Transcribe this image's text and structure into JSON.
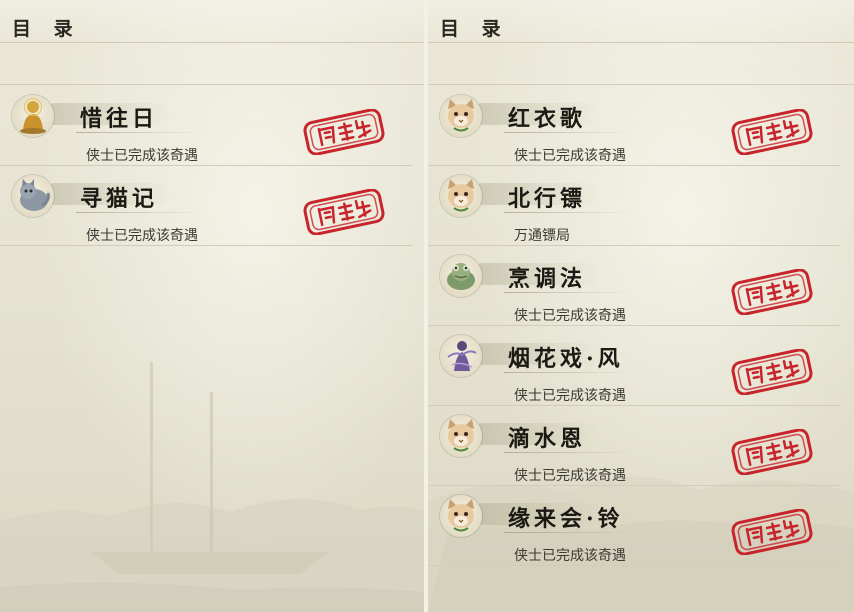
{
  "colors": {
    "seal": "#c8242c",
    "ink": "#1c1914",
    "paper": "#e6e3d2"
  },
  "left_panel": {
    "title": "目 录",
    "entries": [
      {
        "title": "惜往日",
        "status": "侠士已完成该奇遇",
        "icon": "golden-buddha-icon",
        "completed": true
      },
      {
        "title": "寻猫记",
        "status": "侠士已完成该奇遇",
        "icon": "grey-cat-icon",
        "completed": true
      }
    ]
  },
  "right_panel": {
    "title": "目 录",
    "entries": [
      {
        "title": "红衣歌",
        "status": "侠士已完成该奇遇",
        "icon": "cat-face-icon",
        "completed": true
      },
      {
        "title": "北行镖",
        "status": "万通镖局",
        "icon": "cat-face-icon",
        "completed": false
      },
      {
        "title": "烹调法",
        "status": "侠士已完成该奇遇",
        "icon": "green-toad-icon",
        "completed": true
      },
      {
        "title": "烟花戏·风",
        "status": "侠士已完成该奇遇",
        "icon": "purple-figure-icon",
        "completed": true
      },
      {
        "title": "滴水恩",
        "status": "侠士已完成该奇遇",
        "icon": "cat-face-icon",
        "completed": true
      },
      {
        "title": "缘来会·铃",
        "status": "侠士已完成该奇遇",
        "icon": "cat-face-icon",
        "completed": true
      }
    ]
  }
}
